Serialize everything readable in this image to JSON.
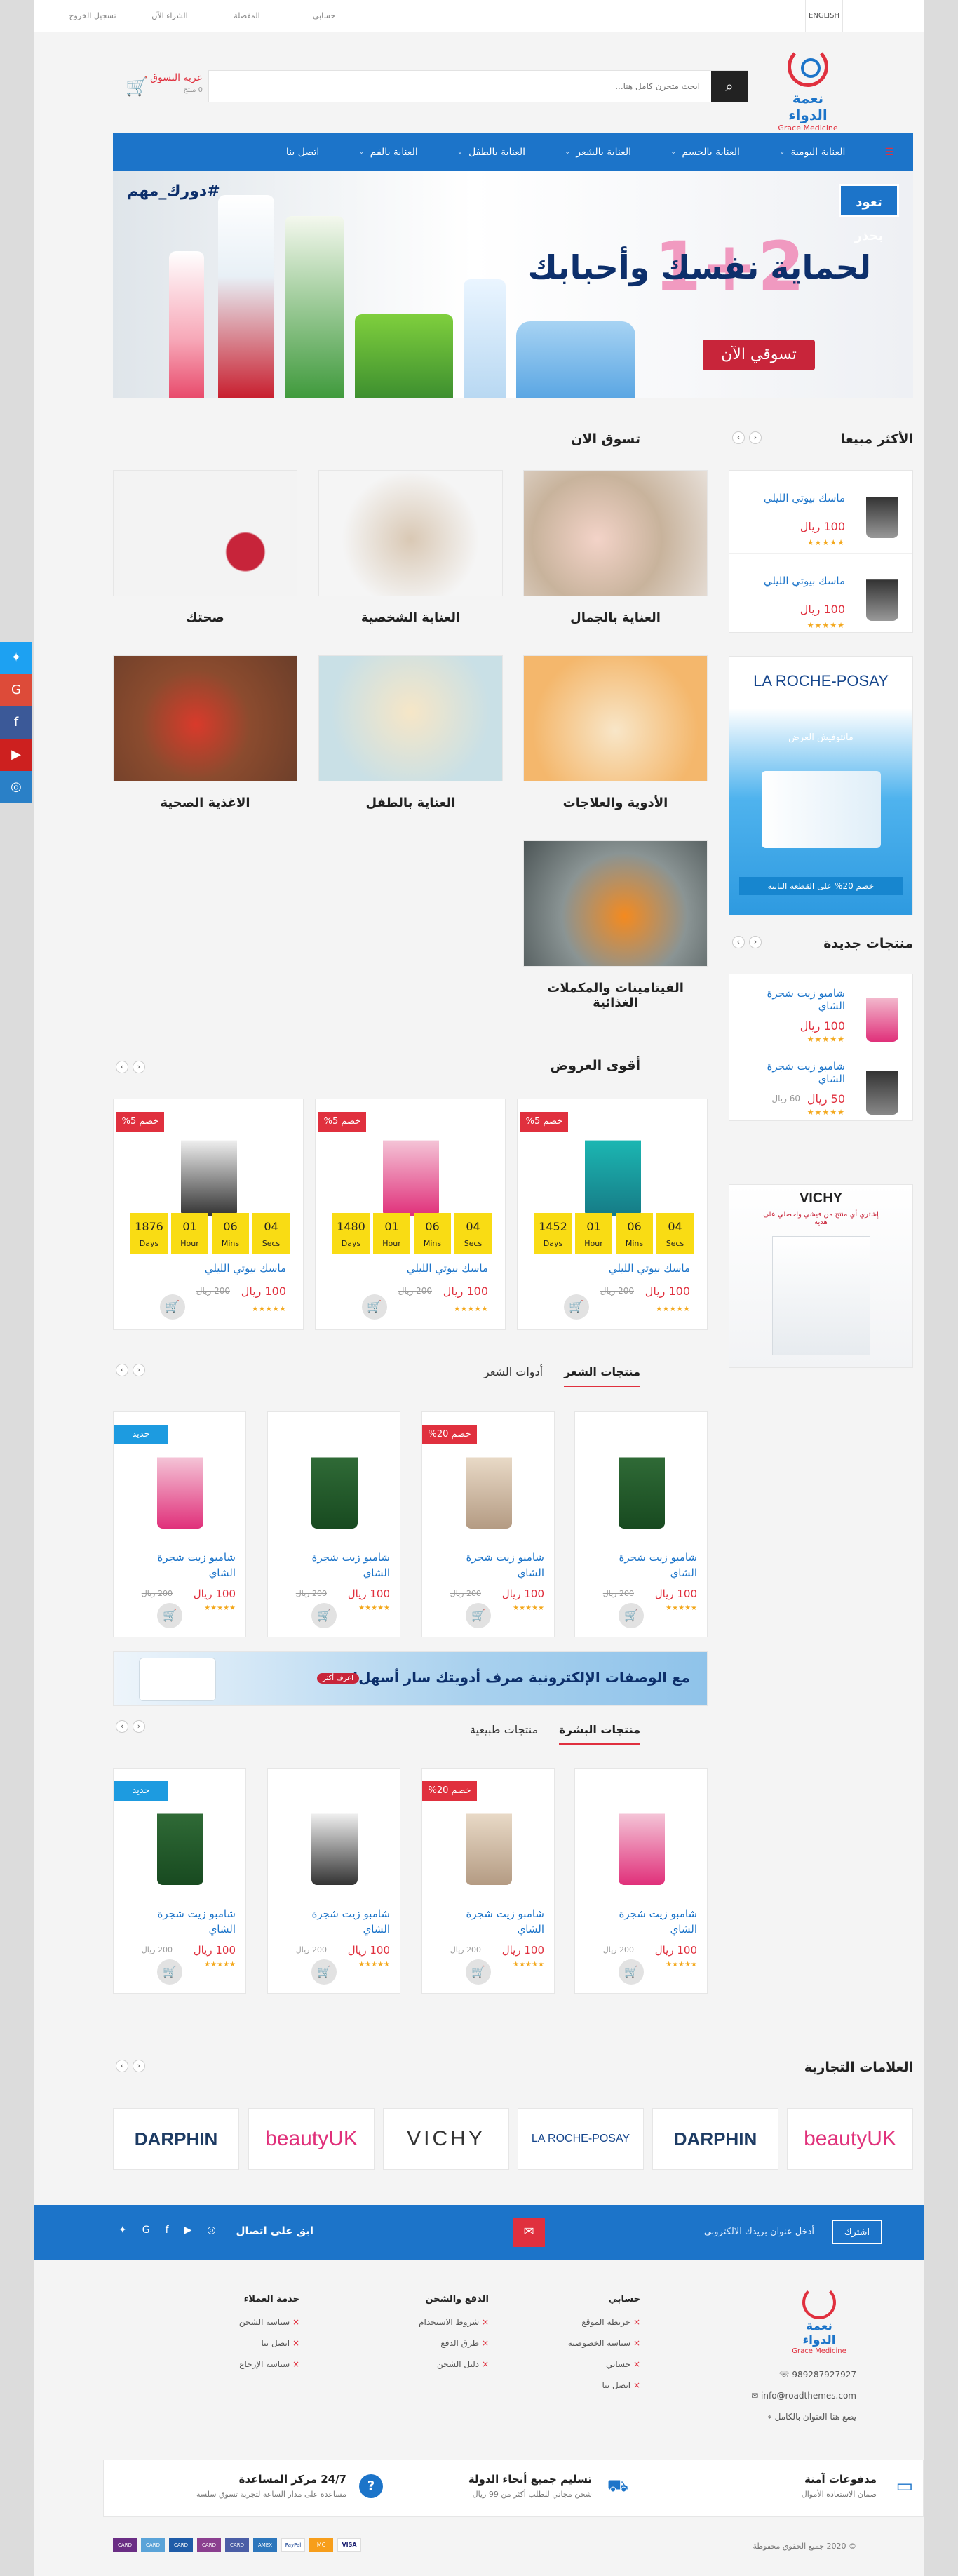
{
  "topbar": {
    "lang": "ENGLISH",
    "links": [
      "حسابي",
      "المفضلة",
      "الشراء الآن",
      "تسجيل الخروج"
    ]
  },
  "brand": {
    "name_ar": "نعمة الدواء",
    "name_en": "Grace Medicine"
  },
  "search": {
    "placeholder": "ابحث متجرن كامل هنا..."
  },
  "cart": {
    "title": "عربة التسوق",
    "count": "0 منتج"
  },
  "nav": {
    "items": [
      {
        "label": "العناية اليومية",
        "dropdown": true
      },
      {
        "label": "العناية بالجسم",
        "dropdown": true
      },
      {
        "label": "العناية بالشعر",
        "dropdown": true
      },
      {
        "label": "العناية بالطفل",
        "dropdown": true
      },
      {
        "label": "العناية بالفم",
        "dropdown": true
      },
      {
        "label": "اتصل بنا",
        "dropdown": false
      }
    ]
  },
  "hero": {
    "hashtag": "#دورك_مهم",
    "badge": "تعود بحذر",
    "promo": "1+2",
    "headline": "لحماية نفسك وأحبابك",
    "cta": "تسوقي الآن"
  },
  "best_sellers": {
    "title": "الأكثر مبيعا",
    "items": [
      {
        "name": "ماسك بيوتي الليلي",
        "price": "100 ريال",
        "old": "",
        "stars": "★★★★★"
      },
      {
        "name": "ماسك بيوتي الليلي",
        "price": "100 ريال",
        "old": "",
        "stars": "★★★★★"
      }
    ]
  },
  "shop_now": {
    "title": "تسوق الان",
    "categories": [
      "العناية بالجمال",
      "العناية الشخصية",
      "صحتك",
      "الأدوية والعلاجات",
      "العناية بالطفل",
      "الاغذية الصحية",
      "الفيتامينات والمكملات الغذائية"
    ]
  },
  "side_banner_1": {
    "brand": "LA ROCHE-POSAY",
    "text": "مانتوفيش العرض",
    "offer": "خصم 20% على القطعة الثانية"
  },
  "new_products": {
    "title": "منتجات جديدة",
    "items": [
      {
        "name": "شامبو زيت شجرة الشاي",
        "price": "100 ريال",
        "old": "",
        "stars": "★★★★★"
      },
      {
        "name": "شامبو زيت شجرة الشاي",
        "price": "50 ريال",
        "old": "60 ريال",
        "stars": "★★★★★"
      }
    ]
  },
  "side_banner_2": {
    "brand": "VICHY",
    "text": "إشتري أي منتج من فيشي واحصلي على هدية"
  },
  "offers": {
    "title": "أقوى العروض",
    "items": [
      {
        "discount": "خصم 5%",
        "name": "ماسك بيوتي الليلي",
        "price": "100 ريال",
        "old": "200 ريال",
        "stars": "★★★★★",
        "timer": {
          "days": "1452",
          "hours": "01",
          "mins": "06",
          "secs": "04"
        }
      },
      {
        "discount": "خصم 5%",
        "name": "ماسك بيوتي الليلي",
        "price": "100 ريال",
        "old": "200 ريال",
        "stars": "★★★★★",
        "timer": {
          "days": "1480",
          "hours": "01",
          "mins": "06",
          "secs": "04"
        }
      },
      {
        "discount": "خصم 5%",
        "name": "ماسك بيوتي الليلي",
        "price": "100 ريال",
        "old": "200 ريال",
        "stars": "★★★★★",
        "timer": {
          "days": "1876",
          "hours": "01",
          "mins": "06",
          "secs": "04"
        }
      }
    ],
    "units": {
      "days": "Days",
      "hours": "Hour",
      "mins": "Mins",
      "secs": "Secs"
    }
  },
  "hair": {
    "tabs": [
      "منتجات الشعر",
      "أدوات الشعر"
    ],
    "items": [
      {
        "flag": "",
        "name": "شامبو زيت شجرة الشاي",
        "price": "100 ريال",
        "old": "200 ريال",
        "stars": "★★★★★"
      },
      {
        "flag": "خصم 20%",
        "name": "شامبو زيت شجرة الشاي",
        "price": "100 ريال",
        "old": "200 ريال",
        "stars": "★★★★★"
      },
      {
        "flag": "",
        "name": "شامبو زيت شجرة الشاي",
        "price": "100 ريال",
        "old": "200 ريال",
        "stars": "★★★★★"
      },
      {
        "flag": "جديد",
        "name": "شامبو زيت شجرة الشاي",
        "price": "100 ريال",
        "old": "200 ريال",
        "stars": "★★★★★"
      }
    ]
  },
  "rx_banner": {
    "text": "مع الوصفات الإلكترونية صرف أدويتك سار أسهل!",
    "btn": "اعرف أكثر"
  },
  "skin": {
    "tabs": [
      "منتجات البشرة",
      "منتجات طبيعية"
    ],
    "items": [
      {
        "flag": "",
        "name": "شامبو زيت شجرة الشاي",
        "price": "100 ريال",
        "old": "200 ريال",
        "stars": "★★★★★"
      },
      {
        "flag": "خصم 20%",
        "name": "شامبو زيت شجرة الشاي",
        "price": "100 ريال",
        "old": "200 ريال",
        "stars": "★★★★★"
      },
      {
        "flag": "",
        "name": "شامبو زيت شجرة الشاي",
        "price": "100 ريال",
        "old": "200 ريال",
        "stars": "★★★★★"
      },
      {
        "flag": "جديد",
        "name": "شامبو زيت شجرة الشاي",
        "price": "100 ريال",
        "old": "200 ريال",
        "stars": "★★★★★"
      }
    ]
  },
  "brands": {
    "title": "العلامات التجارية",
    "items": [
      "beautyUK",
      "DARPHIN",
      "LA ROCHE-POSAY",
      "VICHY",
      "beautyUK",
      "DARPHIN"
    ]
  },
  "newsletter": {
    "btn": "اشترك",
    "placeholder": "أدخل عنوان بريدك الالكتروني",
    "follow": "ابق على اتصال"
  },
  "footer": {
    "phone": "989287927927",
    "email": "info@roadthemes.com",
    "address": "يضع هنا العنوان بالكامل",
    "col_account": {
      "title": "حسابي",
      "links": [
        "خريطة الموقع",
        "سياسة الخصوصية",
        "حسابي",
        "اتصل بنا"
      ]
    },
    "col_pay": {
      "title": "الدفع والشحن",
      "links": [
        "شروط الاستخدام",
        "طرق الدفع",
        "دليل الشحن"
      ]
    },
    "col_service": {
      "title": "خدمة العملاء",
      "links": [
        "سياسة الشحن",
        "اتصل بنا",
        "سياسة الإرجاع"
      ]
    }
  },
  "features": [
    {
      "title": "مدفوعات آمنة",
      "sub": "ضمان الاستعادة الأموال"
    },
    {
      "title": "تسليم جميع أنحاء الدولة",
      "sub": "شحن مجاني للطلب أكثر من 99 ريال"
    },
    {
      "title": "24/7 مركز المساعدة",
      "sub": "مساعدة على مدار الساعة لتجربة تسوق سلسة"
    }
  ],
  "copyright": "© 2020 جميع الحقوق محفوظة",
  "payments": [
    "VISA",
    "MC",
    "PayPal",
    "AMEX",
    "CARD",
    "CARD",
    "CARD",
    "CARD",
    "CARD"
  ],
  "colors": {
    "primary": "#1c74c9",
    "accent": "#e0303e",
    "timer": "#f9dc14",
    "star": "#f3a81d",
    "twitter": "#1da1f2",
    "gplus": "#dd4b39",
    "facebook": "#3b5998",
    "youtube": "#cd201f",
    "instagram": "#2a80c7"
  }
}
